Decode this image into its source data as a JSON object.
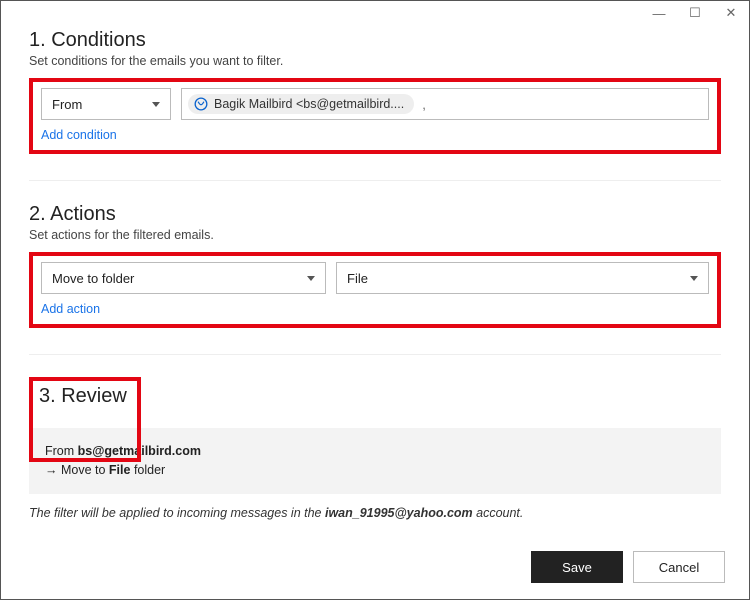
{
  "window": {
    "minimize_glyph": "—",
    "maximize_glyph": "☐",
    "close_glyph": "✕"
  },
  "sections": {
    "conditions": {
      "heading": "1. Conditions",
      "subtitle": "Set conditions for the emails you want to filter.",
      "field_selector": "From",
      "chip_label": "Bagik Mailbird  <bs@getmailbird....",
      "trailing_comma": ",",
      "add_link": "Add condition"
    },
    "actions": {
      "heading": "2. Actions",
      "subtitle": "Set actions for the filtered emails.",
      "action_selector": "Move to folder",
      "folder_selector": "File",
      "add_link": "Add action"
    },
    "review": {
      "heading": "3. Review",
      "from_prefix": "From ",
      "from_value": "bs@getmailbird.com",
      "move_prefix": "→  Move to ",
      "folder_value": "File",
      "move_suffix": " folder"
    }
  },
  "footnote": {
    "prefix": "The filter will be applied to incoming messages in the ",
    "account": "iwan_91995@yahoo.com",
    "suffix": " account."
  },
  "buttons": {
    "save": "Save",
    "cancel": "Cancel"
  }
}
